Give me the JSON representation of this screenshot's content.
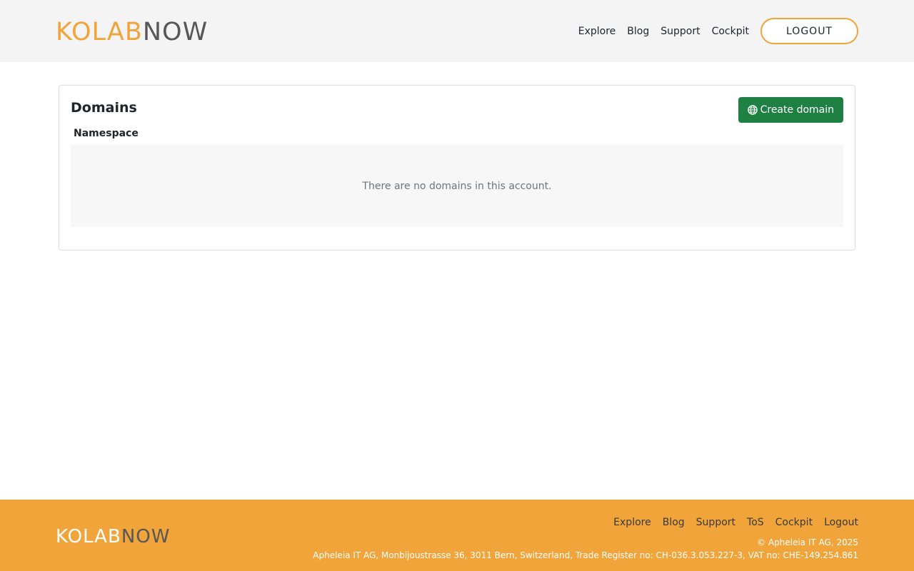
{
  "header": {
    "logo": {
      "part1": "KOLAB",
      "part2": "NOW"
    },
    "nav": [
      {
        "label": "Explore"
      },
      {
        "label": "Blog"
      },
      {
        "label": "Support"
      },
      {
        "label": "Cockpit"
      }
    ],
    "logout_label": "LOGOUT"
  },
  "main": {
    "title": "Domains",
    "create_button": {
      "label": "Create domain",
      "icon": "globe-icon"
    },
    "table": {
      "columns": [
        "Namespace"
      ],
      "empty_message": "There are no domains in this account."
    }
  },
  "footer": {
    "logo": {
      "part1": "KOLAB",
      "part2": "NOW"
    },
    "nav": [
      {
        "label": "Explore"
      },
      {
        "label": "Blog"
      },
      {
        "label": "Support"
      },
      {
        "label": "ToS"
      },
      {
        "label": "Cockpit"
      },
      {
        "label": "Logout"
      }
    ],
    "copyright": "© Apheleia IT AG, 2025",
    "address": "Apheleia IT AG, Monbijoustrasse 36, 3011 Bern, Switzerland, Trade Register no: CH-036.3.053.227-3, VAT no: CHE-149.254.861"
  },
  "colors": {
    "accent": "#f0a43a",
    "primary_button": "#1f8043",
    "header_bg": "#f4f4f4",
    "empty_bg": "#f7f7f7"
  }
}
